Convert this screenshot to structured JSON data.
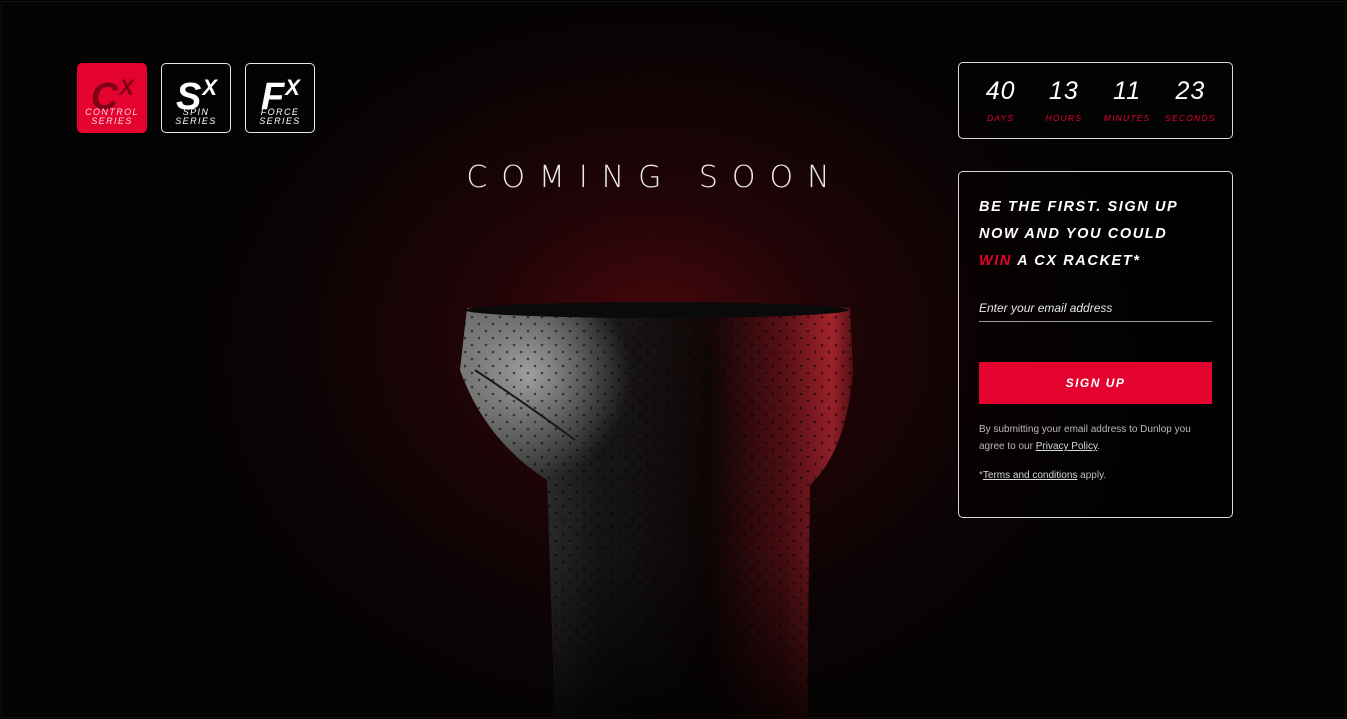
{
  "series": [
    {
      "letter": "C",
      "sup": "X",
      "name_line1": "CONTROL",
      "name_line2": "SERIES",
      "active": true
    },
    {
      "letter": "S",
      "sup": "X",
      "name_line1": "SPIN",
      "name_line2": "SERIES",
      "active": false
    },
    {
      "letter": "F",
      "sup": "X",
      "name_line1": "FORCE",
      "name_line2": "SERIES",
      "active": false
    }
  ],
  "heading": "COMING SOON",
  "countdown": {
    "days": "40",
    "days_label": "DAYS",
    "hours": "13",
    "hours_label": "HOURS",
    "minutes": "11",
    "minutes_label": "MINUTES",
    "seconds": "23",
    "seconds_label": "SECONDS"
  },
  "signup": {
    "promo_line1": "BE THE FIRST. SIGN UP",
    "promo_line2": "NOW AND YOU COULD",
    "promo_win": "WIN",
    "promo_rest": " A CX RACKET*",
    "email_placeholder": "Enter your email address",
    "button_label": "SIGN UP",
    "legal_text": "By submitting your email address to Dunlop you agree to our ",
    "privacy_link": "Privacy Policy",
    "legal_end": ".",
    "terms_prefix": "*",
    "terms_link": "Terms and conditions",
    "terms_suffix": " apply."
  },
  "colors": {
    "accent": "#e4032e",
    "background": "#030303",
    "text": "#ffffff"
  }
}
